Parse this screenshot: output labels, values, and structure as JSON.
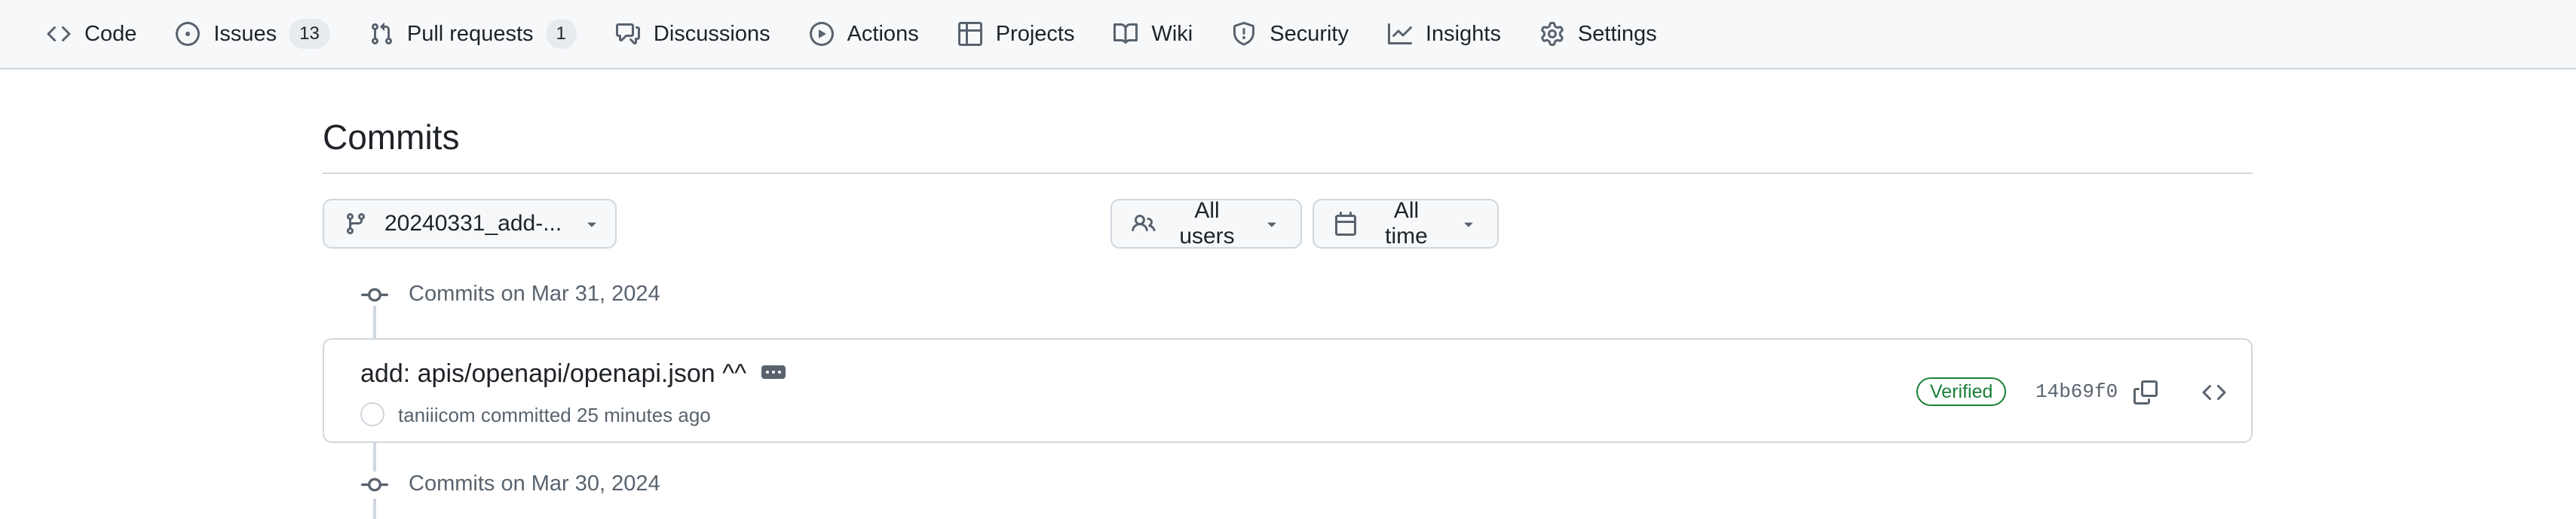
{
  "repo_nav": {
    "items": [
      {
        "label": "Code",
        "icon": "code-icon"
      },
      {
        "label": "Issues",
        "icon": "issue-opened-icon",
        "count": "13"
      },
      {
        "label": "Pull requests",
        "icon": "git-pull-request-icon",
        "count": "1"
      },
      {
        "label": "Discussions",
        "icon": "comment-discussion-icon"
      },
      {
        "label": "Actions",
        "icon": "play-icon"
      },
      {
        "label": "Projects",
        "icon": "table-icon"
      },
      {
        "label": "Wiki",
        "icon": "book-icon"
      },
      {
        "label": "Security",
        "icon": "shield-icon"
      },
      {
        "label": "Insights",
        "icon": "graph-icon"
      },
      {
        "label": "Settings",
        "icon": "gear-icon"
      }
    ]
  },
  "page": {
    "title": "Commits"
  },
  "filters": {
    "branch": "20240331_add-...",
    "users": "All users",
    "time": "All time"
  },
  "commit_groups": [
    {
      "heading": "Commits on Mar 31, 2024",
      "commits": [
        {
          "message": "add: apis/openapi/openapi.json ^^",
          "author": "taniiicom",
          "action": "committed",
          "time": "25 minutes ago",
          "badge": "Verified",
          "sha": "14b69f0"
        }
      ]
    },
    {
      "heading": "Commits on Mar 30, 2024",
      "commits": []
    }
  ],
  "colors": {
    "nav_bg": "#f6f8fa",
    "border": "#d0d7de",
    "text": "#1f2328",
    "muted": "#59636e",
    "verified": "#1a7f37"
  }
}
